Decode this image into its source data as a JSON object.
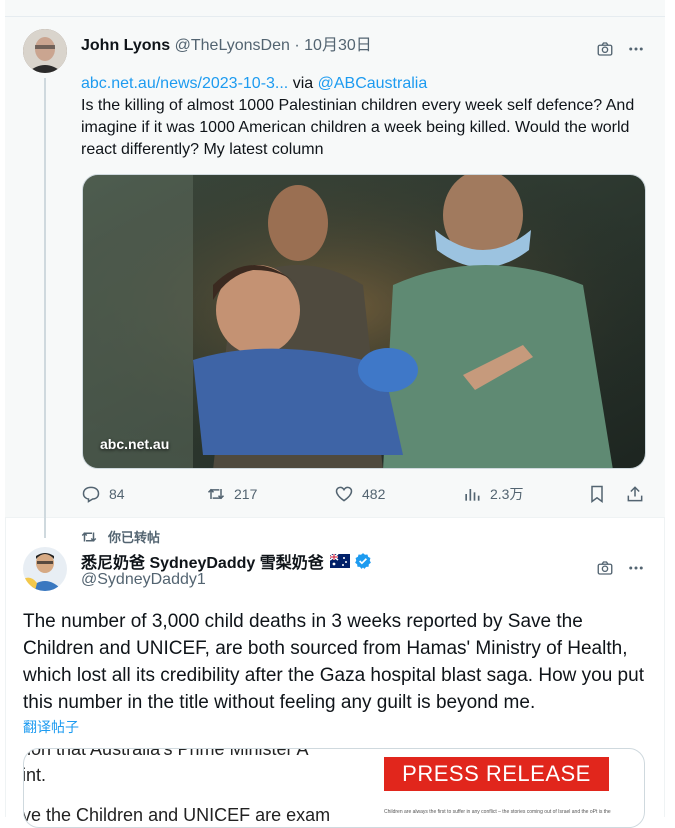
{
  "quoted_tweet": {
    "author_name": "John Lyons",
    "handle": "@TheLyonsDen",
    "separator": "·",
    "date": "10月30日",
    "link_text": "abc.net.au/news/2023-10-3...",
    "via_text": "via",
    "via_handle": "@ABCaustralia",
    "text": "Is the killing of almost 1000 Palestinian children every week self defence? And imagine if it was 1000 American children a week being killed. Would the world react differently? My latest column",
    "photo_source": "abc.net.au",
    "actions": {
      "replies": "84",
      "retweets": "217",
      "likes": "482",
      "views": "2.3万"
    }
  },
  "retweet_banner": {
    "label": "你已转帖"
  },
  "main_tweet": {
    "author_name": "悉尼奶爸 SydneyDaddy 雪梨奶爸",
    "flag": "🇦🇺",
    "handle": "@SydneyDaddy1",
    "text": "The number of 3,000 child deaths in 3 weeks reported by Save the Children and UNICEF, are both sourced from Hamas' Ministry of Health, which lost all its credibility after the Gaza hospital blast saga. How you put this number in the title without feeling any guilt is beyond me.",
    "translate_label": "翻译帖子",
    "media_text_line1": "tion that Australia's Prime Minister A",
    "media_text_line2": "int.",
    "media_text_line3": "ve the Children and UNICEF are exam",
    "press_release_label": "PRESS RELEASE",
    "press_release_small": "Children are always the first to suffer in any conflict – the stories coming out of Israel and the oPt is the"
  },
  "colors": {
    "accent": "#1d9bf0",
    "text": "#0f1419",
    "muted": "#536471",
    "press_red": "#e1261c"
  }
}
